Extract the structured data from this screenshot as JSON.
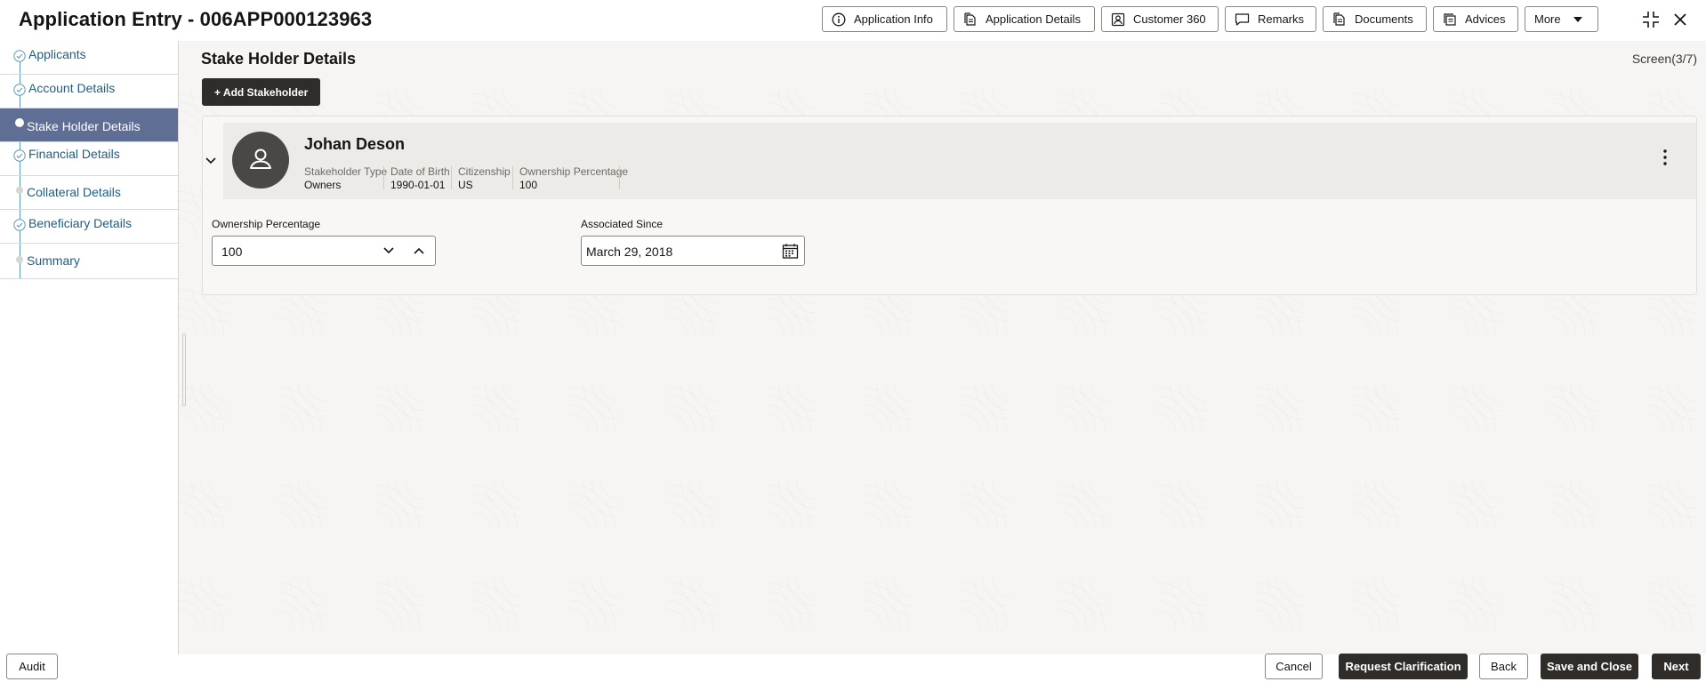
{
  "header": {
    "title": "Application Entry - 006APP000123963",
    "buttons": {
      "application_info": "Application Info",
      "application_details": "Application Details",
      "customer_360": "Customer 360",
      "remarks": "Remarks",
      "documents": "Documents",
      "advices": "Advices",
      "more": "More"
    },
    "icons": [
      "info-icon",
      "document-icon",
      "user-card-icon",
      "comment-icon",
      "document-icon",
      "advices-icon",
      "caret-down-icon",
      "collapse-icon",
      "close-icon"
    ]
  },
  "sidebar": {
    "items": [
      {
        "label": "Applicants",
        "state": "completed"
      },
      {
        "label": "Account Details",
        "state": "completed"
      },
      {
        "label": "Stake Holder Details",
        "state": "active"
      },
      {
        "label": "Financial Details",
        "state": "completed"
      },
      {
        "label": "Collateral Details",
        "state": "pending"
      },
      {
        "label": "Beneficiary Details",
        "state": "completed"
      },
      {
        "label": "Summary",
        "state": "pending"
      }
    ]
  },
  "main": {
    "section_title": "Stake Holder Details",
    "screen_count": "Screen(3/7)",
    "add_button": "+ Add Stakeholder",
    "stakeholder": {
      "name": "Johan Deson",
      "meta": [
        {
          "key": "Stakeholder Type",
          "value": "Owners"
        },
        {
          "key": "Date of Birth",
          "value": "1990-01-01"
        },
        {
          "key": "Citizenship",
          "value": "US"
        },
        {
          "key": "Ownership Percentage",
          "value": "100"
        }
      ],
      "form": {
        "ownership_label": "Ownership Percentage",
        "ownership_value": "100",
        "associated_label": "Associated Since",
        "associated_value": "March 29, 2018"
      }
    }
  },
  "footer": {
    "audit": "Audit",
    "cancel": "Cancel",
    "request_clarification": "Request Clarification",
    "back": "Back",
    "save_and_close": "Save and Close",
    "next": "Next"
  },
  "colors": {
    "nav_active_bg": "#5f6e94",
    "nav_link": "#1f5d83",
    "primary_dark": "#302c29"
  }
}
